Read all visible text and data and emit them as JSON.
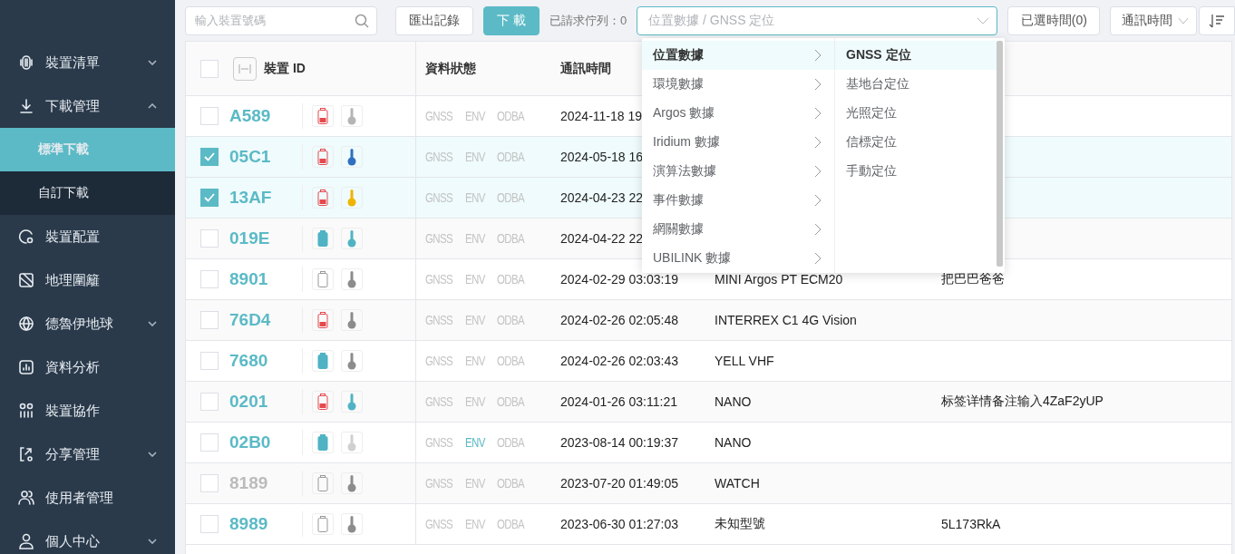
{
  "sidebar": {
    "items": [
      {
        "label": "裝置清單",
        "expanded": false
      },
      {
        "label": "下載管理",
        "expanded": true,
        "children": [
          {
            "label": "標準下載",
            "selected": true
          },
          {
            "label": "自訂下載",
            "selected": false
          }
        ]
      },
      {
        "label": "裝置配置"
      },
      {
        "label": "地理圍籬"
      },
      {
        "label": "德魯伊地球",
        "expanded": false
      },
      {
        "label": "資料分析"
      },
      {
        "label": "裝置協作"
      },
      {
        "label": "分享管理",
        "expanded": false
      },
      {
        "label": "使用者管理"
      },
      {
        "label": "個人中心",
        "expanded": false
      }
    ]
  },
  "toolbar": {
    "search": {
      "placeholder": "輸入裝置號碼"
    },
    "export_button": "匯出記錄",
    "download_button": "下 載",
    "queue_label": "已請求佇列：0",
    "data_type_select": {
      "placeholder": "位置數據 / GNSS 定位"
    },
    "time_button": "已選時間(0)",
    "sort_select": {
      "value": "通訊時間"
    }
  },
  "table": {
    "select_all": {
      "checked": false
    },
    "columns": [
      "裝置 ID",
      "資料狀態",
      "通訊時間"
    ],
    "rows": [
      {
        "id": "A589",
        "checked": false,
        "disabled": false,
        "battery": {
          "kind": "low"
        },
        "thermometer": {
          "color": "#b5b5b5"
        },
        "tags": [
          {
            "label": "GNSS",
            "active": false
          },
          {
            "label": "ENV",
            "active": false
          },
          {
            "label": "ODBA",
            "active": false
          }
        ],
        "time": "2024-11-18 19"
      },
      {
        "id": "05C1",
        "checked": true,
        "disabled": false,
        "battery": {
          "kind": "low"
        },
        "thermometer": {
          "color": "#2f6fbf"
        },
        "tags": [
          {
            "label": "GNSS",
            "active": false
          },
          {
            "label": "ENV",
            "active": false
          },
          {
            "label": "ODBA",
            "active": false
          }
        ],
        "time": "2024-05-18 16"
      },
      {
        "id": "13AF",
        "checked": true,
        "disabled": false,
        "battery": {
          "kind": "low"
        },
        "thermometer": {
          "color": "#f0b400"
        },
        "tags": [
          {
            "label": "GNSS",
            "active": false
          },
          {
            "label": "ENV",
            "active": false
          },
          {
            "label": "ODBA",
            "active": false
          }
        ],
        "time": "2024-04-23 22"
      },
      {
        "id": "019E",
        "checked": false,
        "disabled": false,
        "battery": {
          "kind": "full"
        },
        "thermometer": {
          "color": "#4fb3c4"
        },
        "tags": [
          {
            "label": "GNSS",
            "active": false
          },
          {
            "label": "ENV",
            "active": false
          },
          {
            "label": "ODBA",
            "active": false
          }
        ],
        "time": "2024-04-22 22"
      },
      {
        "id": "8901",
        "checked": false,
        "disabled": false,
        "battery": {
          "kind": "empty"
        },
        "thermometer": {
          "color": "#8c8c8c"
        },
        "tags": [
          {
            "label": "GNSS",
            "active": false
          },
          {
            "label": "ENV",
            "active": false
          },
          {
            "label": "ODBA",
            "active": false
          }
        ],
        "time": "2024-02-29 03:03:19",
        "model": "MINI Argos PT ECM20",
        "note": "把巴巴爸爸"
      },
      {
        "id": "76D4",
        "checked": false,
        "disabled": false,
        "battery": {
          "kind": "low"
        },
        "thermometer": {
          "color": "#8c8c8c"
        },
        "tags": [
          {
            "label": "GNSS",
            "active": false
          },
          {
            "label": "ENV",
            "active": false
          },
          {
            "label": "ODBA",
            "active": false
          }
        ],
        "time": "2024-02-26 02:05:48",
        "model": "INTERREX C1 4G Vision"
      },
      {
        "id": "7680",
        "checked": false,
        "disabled": false,
        "battery": {
          "kind": "full"
        },
        "thermometer": {
          "color": "#8c8c8c"
        },
        "tags": [
          {
            "label": "GNSS",
            "active": false
          },
          {
            "label": "ENV",
            "active": false
          },
          {
            "label": "ODBA",
            "active": false
          }
        ],
        "time": "2024-02-26 02:03:43",
        "model": "YELL VHF"
      },
      {
        "id": "0201",
        "checked": false,
        "disabled": false,
        "battery": {
          "kind": "low"
        },
        "thermometer": {
          "color": "#4fb3c4"
        },
        "tags": [
          {
            "label": "GNSS",
            "active": false
          },
          {
            "label": "ENV",
            "active": false
          },
          {
            "label": "ODBA",
            "active": false
          }
        ],
        "time": "2024-01-26 03:11:21",
        "model": "NANO",
        "note": "标签详情备注输入4ZaF2yUP"
      },
      {
        "id": "02B0",
        "checked": false,
        "disabled": false,
        "battery": {
          "kind": "full"
        },
        "thermometer": {
          "color": "#d0d0d0"
        },
        "tags": [
          {
            "label": "GNSS",
            "active": false
          },
          {
            "label": "ENV",
            "active": true
          },
          {
            "label": "ODBA",
            "active": false
          }
        ],
        "time": "2023-08-14 00:19:37",
        "model": "NANO"
      },
      {
        "id": "8189",
        "checked": false,
        "disabled": true,
        "battery": {
          "kind": "empty"
        },
        "thermometer": {
          "color": "#8c8c8c"
        },
        "tags": [
          {
            "label": "GNSS",
            "active": false
          },
          {
            "label": "ENV",
            "active": false
          },
          {
            "label": "ODBA",
            "active": false
          }
        ],
        "time": "2023-07-20 01:49:05",
        "model": "WATCH"
      },
      {
        "id": "8989",
        "checked": false,
        "disabled": false,
        "battery": {
          "kind": "empty"
        },
        "thermometer": {
          "color": "#8c8c8c"
        },
        "tags": [
          {
            "label": "GNSS",
            "active": false
          },
          {
            "label": "ENV",
            "active": false
          },
          {
            "label": "ODBA",
            "active": false
          }
        ],
        "time": "2023-06-30 01:27:03",
        "model": "未知型號",
        "note": "5L173RkA"
      }
    ]
  },
  "dropdown": {
    "categories": [
      {
        "label": "位置數據",
        "selected": true
      },
      {
        "label": "環境數據",
        "selected": false
      },
      {
        "label": "Argos 數據",
        "selected": false
      },
      {
        "label": "Iridium 數據",
        "selected": false
      },
      {
        "label": "演算法數據",
        "selected": false
      },
      {
        "label": "事件數據",
        "selected": false
      },
      {
        "label": "網關數據",
        "selected": false
      },
      {
        "label": "UBILINK 數據",
        "selected": false
      }
    ],
    "options": [
      {
        "label": "GNSS 定位",
        "selected": true
      },
      {
        "label": "基地台定位",
        "selected": false
      },
      {
        "label": "光照定位",
        "selected": false
      },
      {
        "label": "信標定位",
        "selected": false
      },
      {
        "label": "手動定位",
        "selected": false
      }
    ]
  }
}
